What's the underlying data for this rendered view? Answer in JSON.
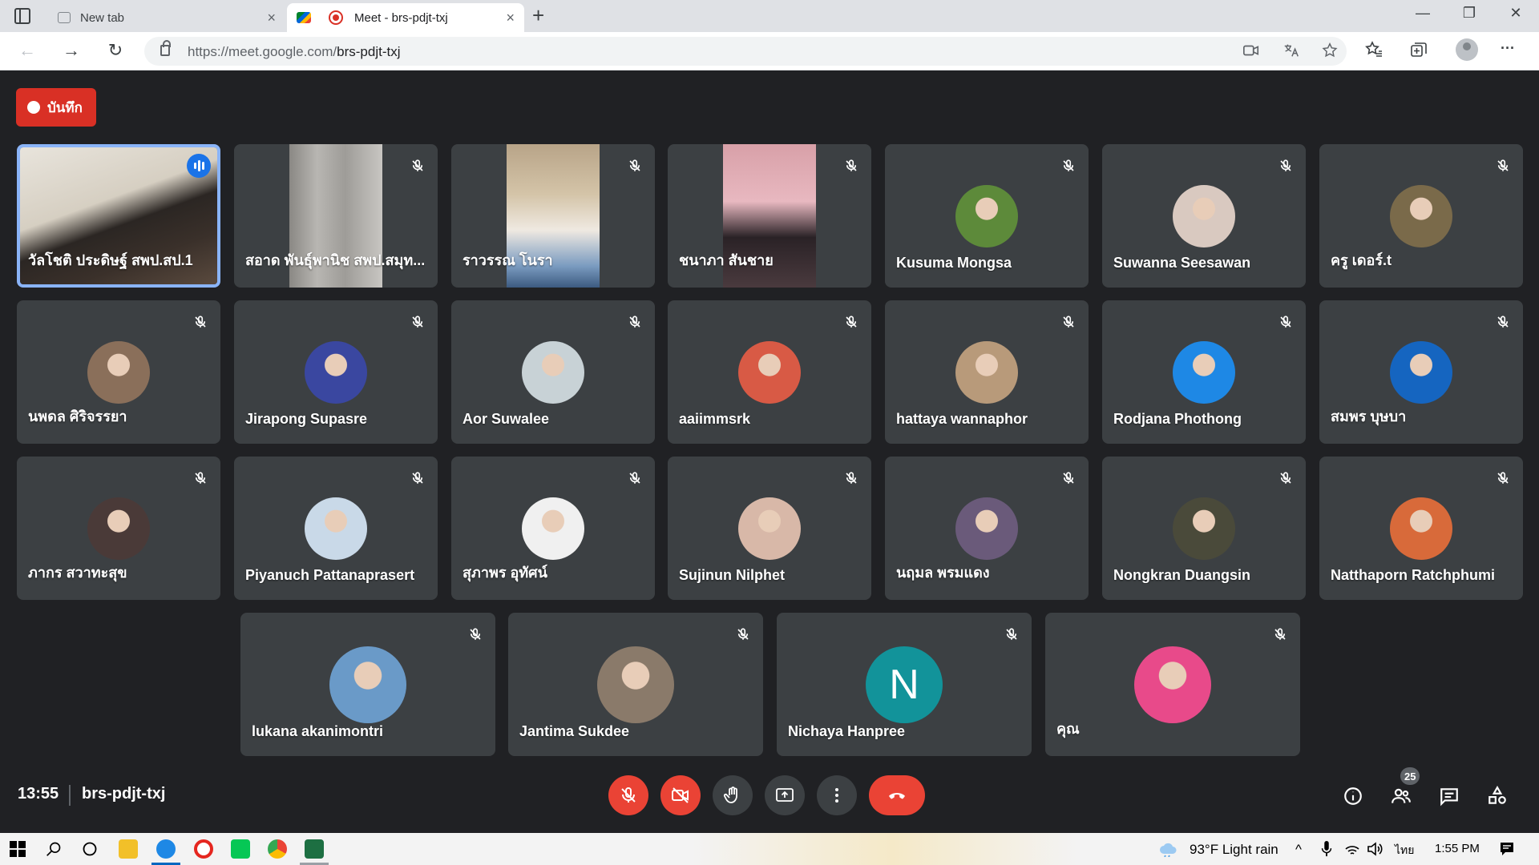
{
  "browser": {
    "tabs": [
      {
        "title": "New tab",
        "close": "×"
      },
      {
        "title": "Meet - brs-pdjt-txj",
        "close": "×"
      }
    ],
    "new_tab": "+",
    "window_controls": {
      "minimize": "—",
      "maximize": "❐",
      "close": "✕"
    },
    "url_host": "https://meet.google.com/",
    "url_path": "brs-pdjt-txj",
    "nav": {
      "back": "←",
      "forward": "→",
      "reload": "↻"
    },
    "toolbar_icons": [
      "camera-icon",
      "read-aloud-icon",
      "favorite-add-icon",
      "favorites-icon",
      "collections-icon",
      "profile-icon",
      "more-icon"
    ],
    "more": "···"
  },
  "meet": {
    "recording_label": "บันทึก",
    "participants": [
      {
        "name": "วัลโชติ ประดิษฐ์ สพป.สป.1",
        "type": "video",
        "speaking": true
      },
      {
        "name": "สอาด พันธุ์พานิช สพป.สมุท...",
        "type": "video"
      },
      {
        "name": "ราวรรณ โนรา",
        "type": "video"
      },
      {
        "name": "ชนาภา สันชาย",
        "type": "video"
      },
      {
        "name": "Kusuma Mongsa",
        "type": "avatar",
        "color": "#5d8a3a"
      },
      {
        "name": "Suwanna Seesawan",
        "type": "avatar",
        "color": "#d9c9c0"
      },
      {
        "name": "ครู เดอร์.t",
        "type": "avatar",
        "color": "#7a6a4a"
      },
      {
        "name": "นพดล ศิริจรรยา",
        "type": "avatar",
        "color": "#8a6f5a"
      },
      {
        "name": "Jirapong Supasre",
        "type": "avatar",
        "color": "#3a47a0"
      },
      {
        "name": "Aor Suwalee",
        "type": "avatar",
        "color": "#c8d2d6"
      },
      {
        "name": "aaiimmsrk",
        "type": "avatar",
        "color": "#d85a45"
      },
      {
        "name": "hattaya wannaphor",
        "type": "avatar",
        "color": "#b89a7a"
      },
      {
        "name": "Rodjana Phothong",
        "type": "avatar",
        "color": "#1e88e5"
      },
      {
        "name": "สมพร บุษบา",
        "type": "avatar",
        "color": "#1565c0"
      },
      {
        "name": "ภากร สวาทะสุข",
        "type": "avatar",
        "color": "#4a3a38"
      },
      {
        "name": "Piyanuch Pattanaprasert",
        "type": "avatar",
        "color": "#c9d9e8"
      },
      {
        "name": "สุภาพร อุทัศน์",
        "type": "avatar",
        "color": "#f0f0f0"
      },
      {
        "name": "Sujinun Nilphet",
        "type": "avatar",
        "color": "#d8b8a8"
      },
      {
        "name": "นฤมล พรมแดง",
        "type": "avatar",
        "color": "#6a5a7a"
      },
      {
        "name": "Nongkran Duangsin",
        "type": "avatar",
        "color": "#4a4a3a"
      },
      {
        "name": "Natthaporn Ratchphumi",
        "type": "avatar",
        "color": "#d86a3a"
      },
      {
        "name": "lukana akanimontri",
        "type": "avatar",
        "color": "#6a9ac8"
      },
      {
        "name": "Jantima Sukdee",
        "type": "avatar",
        "color": "#8a7a6a"
      },
      {
        "name": "Nichaya Hanpree",
        "type": "letter",
        "letter": "N",
        "color": "#12939a"
      },
      {
        "name": "คุณ",
        "type": "avatar",
        "color": "#e84a8a"
      }
    ],
    "clock": "13:55",
    "meeting_code": "brs-pdjt-txj",
    "participant_count": "25",
    "accent_red": "#ea4335",
    "speaking_blue": "#8ab4f8"
  },
  "taskbar": {
    "weather": "93°F  Light rain",
    "lang": "ไทย",
    "time": "1:55 PM",
    "chevron": "^"
  }
}
